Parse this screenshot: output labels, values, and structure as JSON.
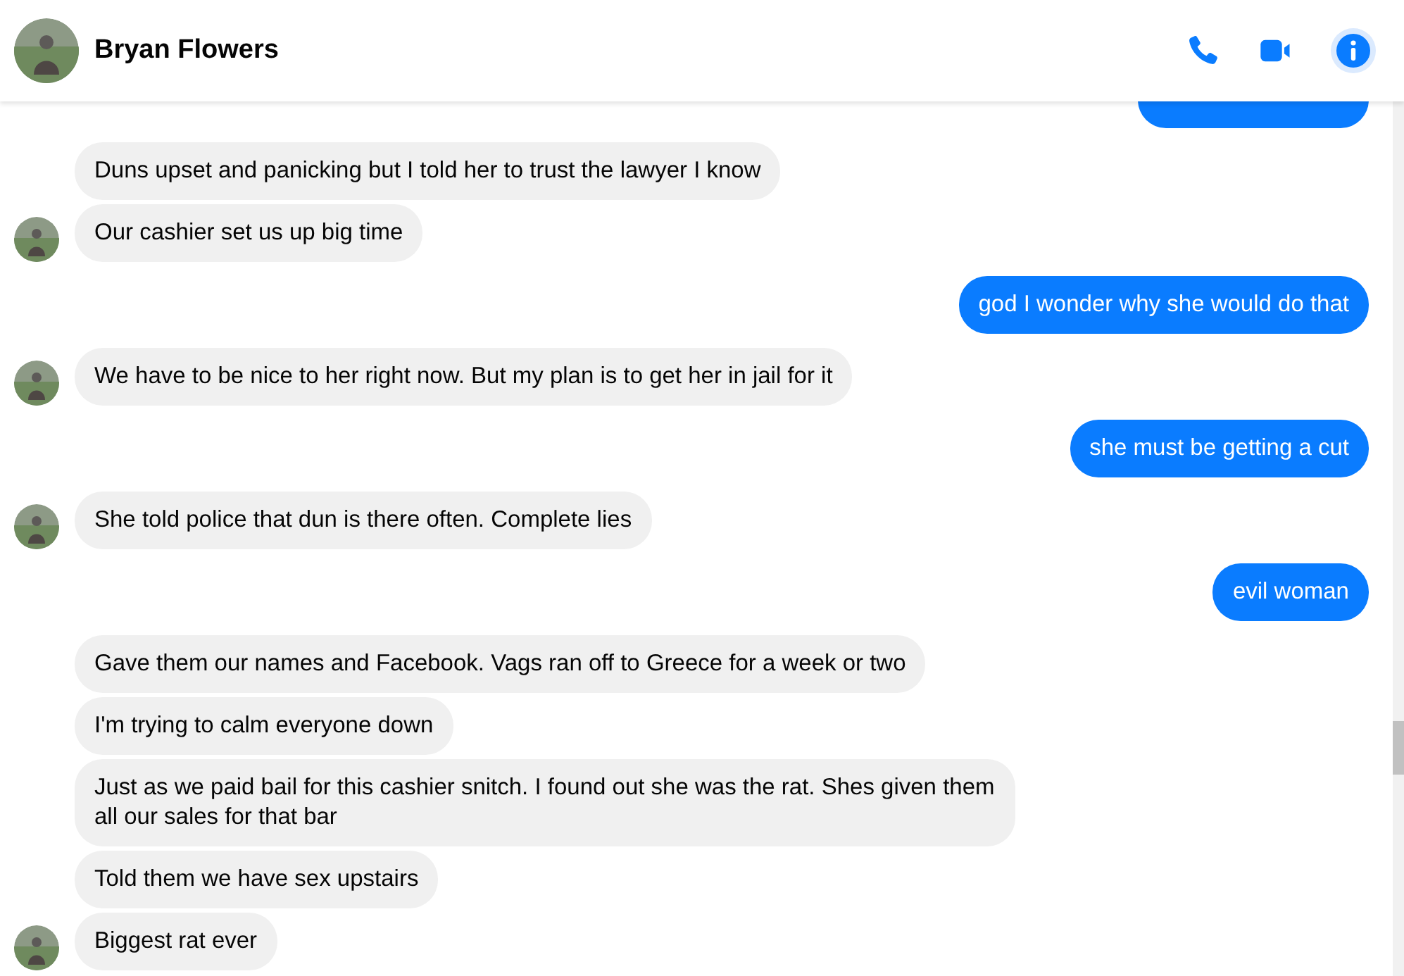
{
  "header": {
    "name": "Bryan Flowers"
  },
  "partly_hidden_outgoing_bubble": true,
  "groups": [
    {
      "kind": "incoming",
      "messages": [
        "Duns upset and panicking but I told her to trust the lawyer I know",
        "Our cashier set us up big time"
      ]
    },
    {
      "kind": "outgoing",
      "messages": [
        "god I wonder why she would do that"
      ]
    },
    {
      "kind": "incoming",
      "messages": [
        "We have to be nice to her right now. But my plan is to get her in jail for it"
      ]
    },
    {
      "kind": "outgoing",
      "messages": [
        "she must be getting a cut"
      ]
    },
    {
      "kind": "incoming",
      "messages": [
        "She told police that dun is there often. Complete lies"
      ]
    },
    {
      "kind": "outgoing",
      "messages": [
        "evil woman"
      ]
    },
    {
      "kind": "incoming",
      "messages": [
        "Gave them our names and Facebook. Vags ran off to Greece for a week or two",
        "I'm trying to calm everyone down",
        "Just as we paid bail for this cashier snitch. I found out she was the rat. Shes given them all our sales for that bar",
        "Told them we have sex upstairs",
        "Biggest rat ever"
      ]
    }
  ]
}
